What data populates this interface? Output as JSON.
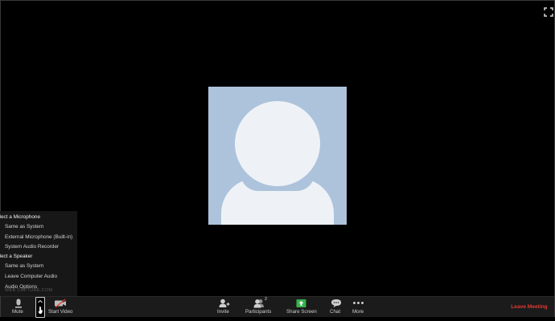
{
  "audio_menu": {
    "microphone_header": "elect a Microphone",
    "microphones": [
      "Same as System",
      "External Microphone (Built-in)",
      "System Audio Recorder"
    ],
    "speaker_header": "elect a Speaker",
    "speakers": [
      "Same as System",
      "Leave Computer Audio"
    ],
    "options": "Audio Options"
  },
  "watermark": "WEB CAPTURE.COM",
  "toolbar": {
    "mute": "Mute",
    "start_video": "Start Video",
    "invite": "Invite",
    "participants": "Participants",
    "participants_count": "2",
    "share_screen": "Share Screen",
    "chat": "Chat",
    "more": "More",
    "leave": "Leave Meeting"
  },
  "colors": {
    "background": "#000000",
    "avatar_bg": "#adc3db",
    "avatar_fg": "#eef2f7",
    "share_green": "#37b24d",
    "leave_red": "#e53935"
  },
  "icons": [
    "fullscreen-icon",
    "microphone-icon",
    "video-off-icon",
    "invite-icon",
    "participants-icon",
    "share-screen-icon",
    "chat-icon",
    "more-icon"
  ]
}
